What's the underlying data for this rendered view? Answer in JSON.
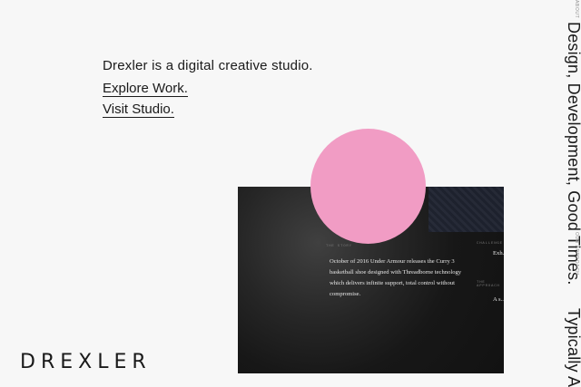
{
  "hero": {
    "tagline": "Drexler is a digital creative studio.",
    "explore_link": "Explore Work.",
    "visit_link": "Visit Studio."
  },
  "brand": {
    "logo_text": "DREXLER"
  },
  "side_rail": {
    "about_label": "ABOUT",
    "about_text": "Design, Development, Good Times.",
    "approach_label": "OUR APPROACH",
    "approach_text": "Typically A"
  },
  "card": {
    "story_label": "THE STORY",
    "story_text": "October of 2016 Under Armour releases the Curry 3 basketball shoe designed with Threadborne technology which delivers infinite support, total control without compromise.",
    "challenge_label": "CHALLENGE",
    "side_text_1": "Exh... prev...",
    "approach_label": "THE APPROACH",
    "side_text_2": "A s... sho... desi... focu..."
  },
  "colors": {
    "background": "#f7f7f7",
    "accent_pink": "#f19cc4",
    "card_dark": "#151515"
  }
}
